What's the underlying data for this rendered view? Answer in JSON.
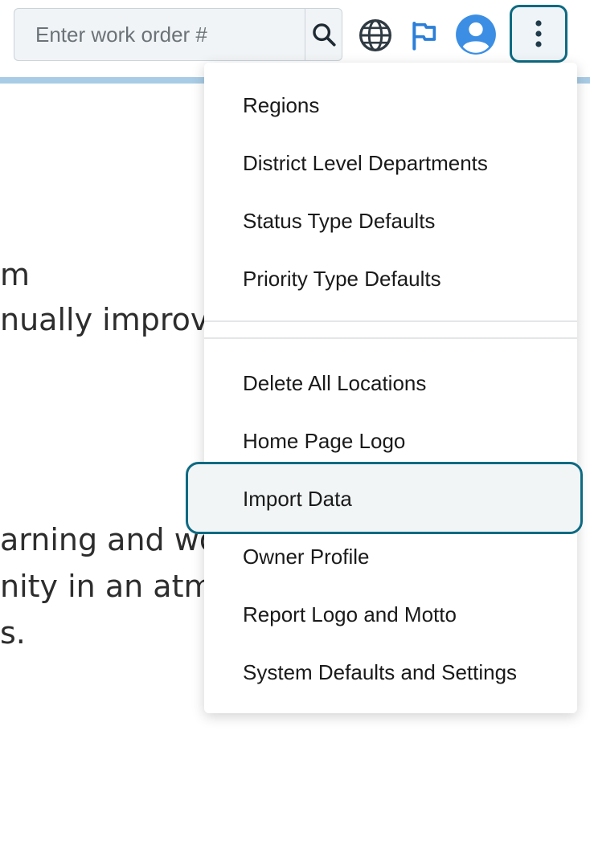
{
  "search": {
    "placeholder": "Enter work order #"
  },
  "icons": {
    "search": "search-icon",
    "globe": "globe-icon",
    "flag": "flag-icon",
    "avatar": "user-avatar-icon",
    "more": "more-vertical-icon"
  },
  "colors": {
    "accent": "#0e6a82",
    "accent_bar": "#a9cce6",
    "avatar_blue": "#3b8ee3"
  },
  "background_text": [
    "m",
    "nually improve",
    "arning and wor",
    "nity in an atmo",
    "s."
  ],
  "menu": {
    "group1": [
      "Regions",
      "District Level Departments",
      "Status Type Defaults",
      "Priority Type Defaults"
    ],
    "group2": [
      "Delete All Locations",
      "Home Page Logo",
      "Import Data",
      "Owner Profile",
      "Report Logo and Motto",
      "System Defaults and Settings"
    ]
  }
}
